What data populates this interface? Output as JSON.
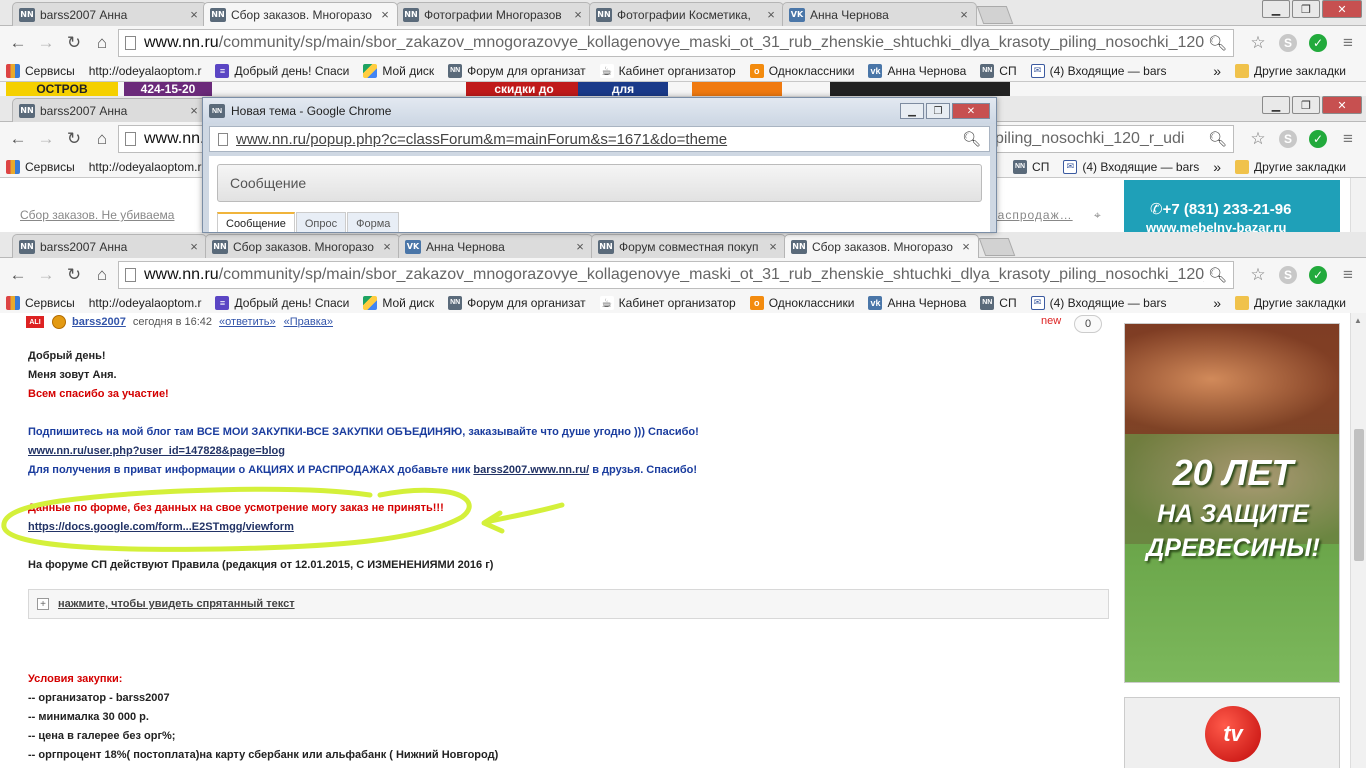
{
  "window1": {
    "tabs": [
      {
        "favicon": "NN",
        "title": "barss2007 Анна",
        "active": false
      },
      {
        "favicon": "NN",
        "title": "Сбор заказов. Многоразо",
        "active": true
      },
      {
        "favicon": "NN",
        "title": "Фотографии Многоразов",
        "active": false
      },
      {
        "favicon": "NN",
        "title": "Фотографии Косметика,",
        "active": false
      },
      {
        "favicon": "VK",
        "title": "Анна Чернова",
        "active": false
      }
    ],
    "url_host": "www.nn.ru",
    "url_path": "/community/sp/main/sbor_zakazov_mnogorazovye_kollagenovye_maski_ot_31_rub_zhenskie_shtuchki_dlya_krasoty_piling_nosochki_120_r_udi",
    "banner_pieces": [
      "OCTPOB",
      "424-15-20",
      "скидки до",
      "для"
    ]
  },
  "bookmarks": [
    {
      "icon": "apps-icon",
      "label": "Сервисы"
    },
    {
      "icon": "page-icon",
      "label": "http://odeyalaoptom.r"
    },
    {
      "icon": "doc-icon",
      "label": "Добрый день! Спаси"
    },
    {
      "icon": "drive-icon",
      "label": "Мой диск"
    },
    {
      "icon": "nn-icon",
      "label": "Форум для организат"
    },
    {
      "icon": "cabinet-icon",
      "label": "Кабинет организатор"
    },
    {
      "icon": "ok-icon",
      "label": "Одноклассники"
    },
    {
      "icon": "vk-icon",
      "label": "Анна Чернова"
    },
    {
      "icon": "nn-icon",
      "label": "СП"
    },
    {
      "icon": "mail-icon",
      "label": "(4) Входящие — bars"
    }
  ],
  "bookmarks_more": "»",
  "bookmarks_other": "Другие закладки",
  "window2": {
    "tabs": [
      {
        "favicon": "NN",
        "title": "barss2007 Анна",
        "active": false
      }
    ],
    "url_host": "www.nn.",
    "url_right": "rasoty_piling_nosochki_120_r_udi",
    "breadcrumb": "Сбор заказов. Не убиваема",
    "breadcrumb_right": "распродаж…",
    "ad_phone": "+7 (831) 233-21-96",
    "ad_site": "www.mebelny-bazar.ru"
  },
  "popup": {
    "title": "Новая тема - Google Chrome",
    "address": "www.nn.ru/popup.php?c=classForum&m=mainForum&s=1671&do=theme",
    "message_placeholder": "Сообщение",
    "tabs": [
      "Сообщение",
      "Опрос",
      "Форма"
    ]
  },
  "window3": {
    "tabs": [
      {
        "favicon": "NN",
        "title": "barss2007 Анна",
        "active": false
      },
      {
        "favicon": "NN",
        "title": "Сбор заказов. Многоразо",
        "active": false
      },
      {
        "favicon": "VK",
        "title": "Анна Чернова",
        "active": false
      },
      {
        "favicon": "NN",
        "title": "Форум совместная покуп",
        "active": false
      },
      {
        "favicon": "NN",
        "title": "Сбор заказов. Многоразо",
        "active": true
      }
    ],
    "url_host": "www.nn.ru",
    "url_path": "/community/sp/main/sbor_zakazov_mnogorazovye_kollagenovye_maski_ot_31_rub_zhenskie_shtuchki_dlya_krasoty_piling_nosochki_120_r_udi"
  },
  "post": {
    "user": "barss2007",
    "time": "сегодня в 16:42",
    "reply": "«ответить»",
    "edit": "«Правка»",
    "new_label": "new",
    "count": "0",
    "greeting": "Добрый день!",
    "intro": "Меня зовут Аня.",
    "thanks": "Всем спасибо за участие!",
    "subscribe": "Подпишитесь на мой блог там ВСЕ МОИ ЗАКУПКИ-ВСЕ ЗАКУПКИ ОБЪЕДИНЯЮ, заказывайте что душе угодно ))) Спасибо!",
    "blog_link": "www.nn.ru/user.php?user_id=147828&page=blog",
    "friends_prefix": "Для получения в приват информации о АКЦИЯХ И РАСПРОДАЖАХ добавьте ник ",
    "friends_link": "barss2007.www.nn.ru/",
    "friends_suffix": " в друзья. Спасибо!",
    "form_notice": "Данные по форме, без данных на свое усмотрение могу заказ не принять!!!",
    "form_link": "https://docs.google.com/form...E2STmgg/viewform",
    "rules": "На форуме СП действуют Правила (редакция от 12.01.2015, С ИЗМЕНЕНИЯМИ 2016 г)",
    "spoiler": "нажмите, чтобы увидеть спрятанный текст",
    "conditions_title": "Условия закупки:",
    "conditions": [
      "-- организатор - barss2007",
      "-- минималка 30 000 р.",
      "-- цена в галерее без орг%;",
      "-- оргпроцент 18%( постоплата)на карту сбербанк или альфабанк ( Нижний Новгород)"
    ]
  },
  "ads": {
    "wood_line1": "20 ЛЕТ",
    "wood_line2": "НА ЗАЩИТЕ",
    "wood_line3": "ДРЕВЕСИНЫ!",
    "tv_label": "tv"
  },
  "colors": {
    "post_red": "#d40000",
    "post_blue": "#1a3c9e",
    "annotation_green": "#d4f03a"
  }
}
